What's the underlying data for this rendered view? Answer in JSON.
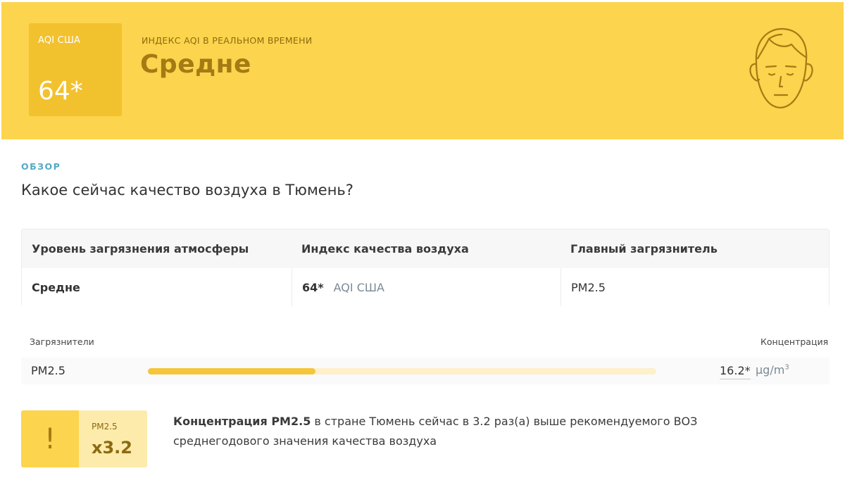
{
  "header": {
    "aqi_box": {
      "label": "AQI США",
      "value": "64*"
    },
    "realtime_label": "ИНДЕКС AQI В РЕАЛЬНОМ ВРЕМЕНИ",
    "level": "Средне",
    "face_icon": "moderate-face-icon"
  },
  "overview": {
    "tag": "ОБЗОР",
    "question": "Какое сейчас качество воздуха в Тюмень?"
  },
  "summary_table": {
    "headers": [
      "Уровень загрязнения атмосферы",
      "Индекс качества воздуха",
      "Главный загрязнитель"
    ],
    "row": {
      "level": "Средне",
      "aqi_value": "64*",
      "aqi_unit": "AQI США",
      "main_pollutant": "PM2.5"
    }
  },
  "pollutants": {
    "header_left": "Загрязнители",
    "header_right": "Концентрация",
    "items": [
      {
        "name": "PM2.5",
        "value": "16.2*",
        "unit": "µg/m",
        "unit_sup": "3",
        "bar_fraction": 0.33
      }
    ]
  },
  "who_notice": {
    "icon": "exclamation-icon",
    "icon_char": "!",
    "ratio_label": "PM2.5",
    "ratio_value": "x3.2",
    "text_bold": "Концентрация PM2.5",
    "text_rest": " в стране Тюмень сейчас в 3.2 раз(а) выше рекомендуемого ВОЗ среднегодового значения качества воздуха"
  },
  "colors": {
    "banner": "#fcd44d",
    "aqi_box": "#f2c12e",
    "accent_text": "#a47b13",
    "overview_tag": "#54a9c7",
    "bar_fill": "#f5c53a",
    "bar_track": "#fdf0cb"
  }
}
